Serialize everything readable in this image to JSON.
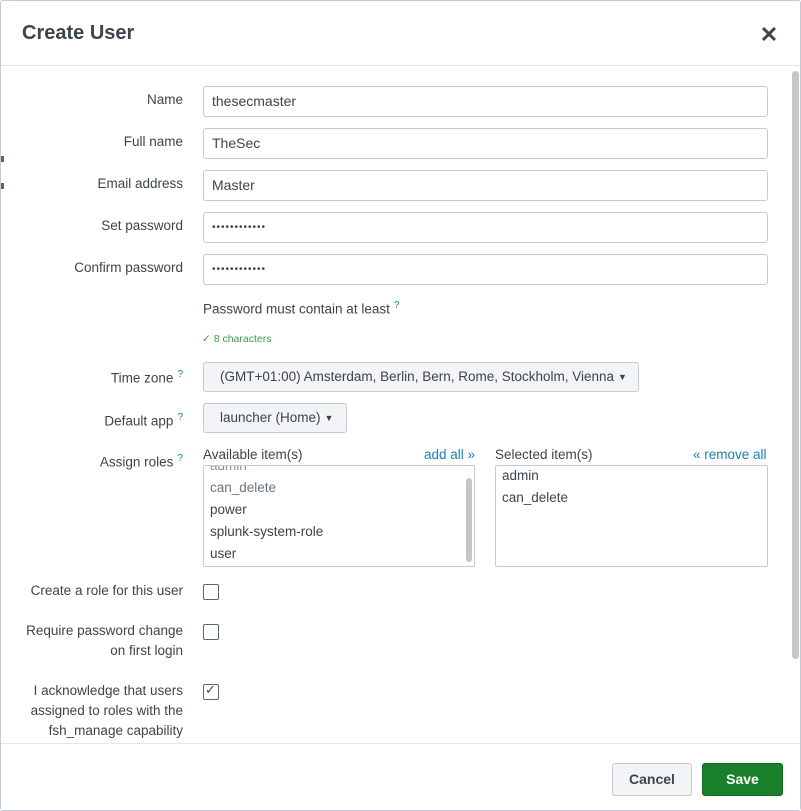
{
  "dialog": {
    "title": "Create User",
    "close_icon": "close-icon"
  },
  "form": {
    "name": {
      "label": "Name",
      "value": "thesecmaster"
    },
    "full_name": {
      "label": "Full name",
      "value": "TheSec"
    },
    "email": {
      "label": "Email address",
      "value": "Master"
    },
    "set_password": {
      "label": "Set password",
      "value": "••••••••••••"
    },
    "confirm_password": {
      "label": "Confirm password",
      "value": "••••••••••••"
    },
    "password_hint": "Password must contain at least",
    "password_help": "?",
    "password_rule": "✓ 8 characters",
    "time_zone": {
      "label": "Time zone",
      "help": "?",
      "value": "(GMT+01:00) Amsterdam, Berlin, Bern, Rome, Stockholm, Vienna"
    },
    "default_app": {
      "label": "Default app",
      "help": "?",
      "value": "launcher (Home)"
    },
    "roles": {
      "label": "Assign roles",
      "help": "?",
      "available_header": "Available item(s)",
      "add_all": "add all »",
      "selected_header": "Selected item(s)",
      "remove_all": "« remove all",
      "available": [
        "admin",
        "can_delete",
        "power",
        "splunk-system-role",
        "user"
      ],
      "selected": [
        "admin",
        "can_delete"
      ]
    },
    "create_role": {
      "label": "Create a role for this user",
      "checked": false
    },
    "require_pw_change": {
      "label_line1": "Require password change",
      "label_line2": "on first login",
      "checked": false
    },
    "acknowledge": {
      "label_line1": "I acknowledge that users",
      "label_line2": "assigned to roles with the",
      "label_line3": "fsh_manage capability",
      "checked": true
    }
  },
  "footer": {
    "cancel_label": "Cancel",
    "save_label": "Save"
  },
  "colors": {
    "save": "#1a7f2a",
    "link": "#1a7fb5",
    "rule_ok": "#3a9a4a"
  }
}
